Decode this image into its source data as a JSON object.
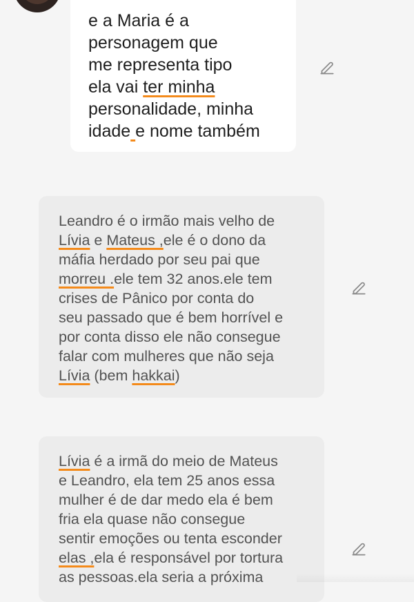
{
  "messages": [
    {
      "role": "user",
      "lines": [
        [
          {
            "t": "e a Maria é a"
          }
        ],
        [
          {
            "t": "personagem que"
          }
        ],
        [
          {
            "t": "me representa tipo"
          }
        ],
        [
          {
            "t": "ela vai "
          },
          {
            "t": "ter minha",
            "u": true
          }
        ],
        [
          {
            "t": "personalidade, minha"
          }
        ],
        [
          {
            "t": "idade"
          },
          {
            "t": " ",
            "u": true
          },
          {
            "t": "e nome também"
          }
        ]
      ]
    },
    {
      "role": "assistant",
      "lines": [
        [
          {
            "t": "Leandro é o irmão mais velho de"
          }
        ],
        [
          {
            "t": "Lívia",
            "u": true
          },
          {
            "t": " e "
          },
          {
            "t": "Mateus ,",
            "u": true
          },
          {
            "t": "ele é o dono da"
          }
        ],
        [
          {
            "t": "máfia herdado por seu pai que"
          }
        ],
        [
          {
            "t": "morreu .",
            "u": true
          },
          {
            "t": "ele tem 32 anos.ele tem"
          }
        ],
        [
          {
            "t": "crises de Pânico por conta do"
          }
        ],
        [
          {
            "t": "seu passado que é bem horrível e"
          }
        ],
        [
          {
            "t": "por conta disso ele não consegue"
          }
        ],
        [
          {
            "t": "falar com mulheres que não seja"
          }
        ],
        [
          {
            "t": "Lívia",
            "u": true
          },
          {
            "t": " (bem "
          },
          {
            "t": "hakkai",
            "u": true
          },
          {
            "t": ")"
          }
        ]
      ]
    },
    {
      "role": "assistant",
      "lines": [
        [
          {
            "t": "Lívia",
            "u": true
          },
          {
            "t": " é a irmã do meio de Mateus"
          }
        ],
        [
          {
            "t": "e Leandro, ela tem 25 anos essa"
          }
        ],
        [
          {
            "t": "mulher é de dar medo ela é bem"
          }
        ],
        [
          {
            "t": "fria ela quase não consegue"
          }
        ],
        [
          {
            "t": "sentir emoções ou tenta esconder"
          }
        ],
        [
          {
            "t": "elas ,",
            "u": true
          },
          {
            "t": "ela é responsável por tortura"
          }
        ],
        [
          {
            "t": "as pessoas.ela seria a próxima"
          }
        ]
      ]
    }
  ],
  "icons": {
    "avatar": "avatar",
    "edit": "pencil-edit-icon"
  },
  "colors": {
    "background": "#f5f5f5",
    "user_bubble": "#ffffff",
    "assistant_bubble": "#ececec",
    "underline": "#f48a1a",
    "icon": "#8a8a8a"
  }
}
